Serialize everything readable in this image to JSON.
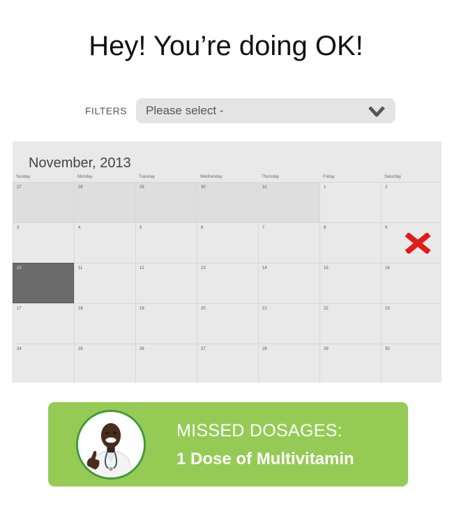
{
  "headline": "Hey! You’re doing OK!",
  "filters": {
    "label": "FILTERS",
    "placeholder": "Please select -"
  },
  "calendar": {
    "month_title": "November, 2013",
    "day_headers": [
      "Sunday",
      "Monday",
      "Tuesday",
      "Wednesday",
      "Thursday",
      "Friday",
      "Saturday"
    ],
    "weeks": [
      [
        "27",
        "28",
        "29",
        "30",
        "31",
        "1",
        "2"
      ],
      [
        "3",
        "4",
        "5",
        "6",
        "7",
        "8",
        "9"
      ],
      [
        "10",
        "11",
        "12",
        "13",
        "14",
        "15",
        "16"
      ],
      [
        "17",
        "18",
        "19",
        "20",
        "21",
        "22",
        "23"
      ],
      [
        "24",
        "25",
        "26",
        "27",
        "28",
        "29",
        "30"
      ]
    ],
    "selected_day": "10",
    "missed_day": "9",
    "colors": {
      "missed_mark": "#e31b1b",
      "selected": "#6b6b6b"
    }
  },
  "summary": {
    "title": "MISSED DOSAGES:",
    "detail": "1 Dose of Multivitamin",
    "background": "#95cb55",
    "icon": "doctor-thumbs-up-avatar"
  }
}
